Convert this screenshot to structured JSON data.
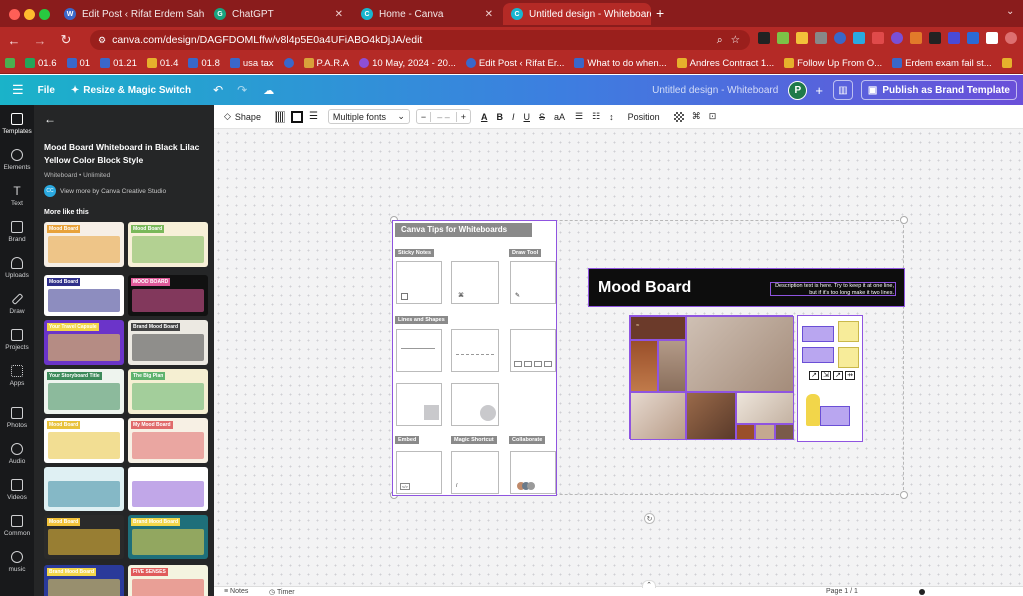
{
  "browser": {
    "tabs": [
      {
        "title": "Edit Post ‹ Rifat Erdem Sahin",
        "icon": "wordpress-icon",
        "color": "#3a67c9"
      },
      {
        "title": "ChatGPT",
        "icon": "chatgpt-icon",
        "color": "#19a37f"
      },
      {
        "title": "Home - Canva",
        "icon": "canva-icon",
        "color": "#18b5cf"
      },
      {
        "title": "Untitled design - Whiteboard",
        "icon": "canva-icon",
        "color": "#18b5cf"
      }
    ],
    "url": "canva.com/design/DAGFDOMLffw/v8l4p5E0a4UFiABO4kDjJA/edit",
    "bookmarks": [
      {
        "label": "01.6",
        "color": "#23a55a"
      },
      {
        "label": "01",
        "color": "#3a67c9"
      },
      {
        "label": "01.21",
        "color": "#3a67c9"
      },
      {
        "label": "01.4",
        "color": "#e6b02c"
      },
      {
        "label": "01.8",
        "color": "#3a67c9"
      },
      {
        "label": "usa tax",
        "color": "#3a67c9"
      },
      {
        "label": "",
        "color": "#3a67c9"
      },
      {
        "label": "P.A.R.A",
        "color": "#d9a13a"
      },
      {
        "label": "10 May, 2024 - 20...",
        "color": "#8e4fd6"
      },
      {
        "label": "Edit Post ‹ Rifat Er...",
        "color": "#3a67c9"
      },
      {
        "label": "What to do when...",
        "color": "#3a67c9"
      },
      {
        "label": "Andres Contract 1...",
        "color": "#e6b02c"
      },
      {
        "label": "Follow Up From O...",
        "color": "#e6b02c"
      },
      {
        "label": "Erdem exam fail st...",
        "color": "#3a67c9"
      }
    ]
  },
  "canva": {
    "menu": {
      "file": "File",
      "resize": "Resize & Magic Switch"
    },
    "doc_title": "Untitled design - Whiteboard",
    "avatar_initial": "P",
    "publish": "Publish as Brand Template",
    "sidebar": [
      {
        "label": "Templates",
        "icon": "templates-icon"
      },
      {
        "label": "Elements",
        "icon": "elements-icon"
      },
      {
        "label": "Text",
        "icon": "text-icon"
      },
      {
        "label": "Brand",
        "icon": "brand-icon"
      },
      {
        "label": "Uploads",
        "icon": "uploads-icon"
      },
      {
        "label": "Draw",
        "icon": "draw-icon"
      },
      {
        "label": "Projects",
        "icon": "projects-icon"
      },
      {
        "label": "Apps",
        "icon": "apps-icon"
      },
      {
        "label": "Photos",
        "icon": "photos-icon"
      },
      {
        "label": "Audio",
        "icon": "audio-icon"
      },
      {
        "label": "Videos",
        "icon": "videos-icon"
      },
      {
        "label": "Common",
        "icon": "common-icon"
      },
      {
        "label": "music",
        "icon": "music-icon"
      }
    ],
    "panel": {
      "title": "Mood Board Whiteboard in Black Lilac Yellow Color Block Style",
      "meta": "Whiteboard • Unlimited",
      "author": "View more by Canva Creative Studio",
      "author_initials": "CC",
      "more_like": "More like this",
      "thumbs": [
        {
          "label": "Mood Board",
          "bg": "#f6efe6",
          "accent": "#e8a23a"
        },
        {
          "label": "Mood Board",
          "bg": "#f8f0d8",
          "accent": "#7ab85a"
        },
        {
          "label": "Mood Board",
          "bg": "#ffffff",
          "accent": "#2f2f8a"
        },
        {
          "label": "MOOD BOARD",
          "bg": "#111111",
          "accent": "#e05a9a"
        },
        {
          "label": "Your Travel Capsule",
          "bg": "#6b34c9",
          "accent": "#f2d64a"
        },
        {
          "label": "Brand Mood Board",
          "bg": "#ece9e2",
          "accent": "#444444"
        },
        {
          "label": "Your Storyboard Title",
          "bg": "#eef4ee",
          "accent": "#3c8a5a"
        },
        {
          "label": "The Big Plan",
          "bg": "#f5efd2",
          "accent": "#5fb36e"
        },
        {
          "label": "Mood Board",
          "bg": "#ffffff",
          "accent": "#e8c23a"
        },
        {
          "label": "My Mood Board",
          "bg": "#f7f0e4",
          "accent": "#e06a6a"
        },
        {
          "label": "",
          "bg": "#dff0f3",
          "accent": "#3a8aa0"
        },
        {
          "label": "",
          "bg": "#ffffff",
          "accent": "#8e5ed6"
        },
        {
          "label": "Mood Board",
          "bg": "#2a2a2a",
          "accent": "#f2c23a"
        },
        {
          "label": "Brand Mood Board",
          "bg": "#1e6f7a",
          "accent": "#f2d64a"
        },
        {
          "label": "Brand Mood Board",
          "bg": "#2a3a9a",
          "accent": "#f2d64a"
        },
        {
          "label": "FIVE SENSES",
          "bg": "#f4f4e0",
          "accent": "#e05a5a"
        }
      ]
    },
    "toolbar": {
      "shape": "Shape",
      "font": "Multiple fonts",
      "font_size": "– –",
      "position": "Position"
    },
    "board": {
      "tips_title": "Canva Tips for Whiteboards",
      "sections": [
        "Sticky Notes",
        "Draw Tool",
        "Lines and Shapes",
        "Embed",
        "Magic Shortcut",
        "Collaborate"
      ],
      "mood_title": "Mood Board",
      "mood_desc": "Description text is here. Try to keep it at one line, but if it's too long make it two lines."
    },
    "footer": {
      "notes": "Notes",
      "timer": "Timer",
      "page": "Page 1 / 1"
    }
  },
  "colors": {
    "tabbar": "#8a1c1c",
    "browser": "#b42a26",
    "purple": "#8f54e0",
    "yellow": "#f7ec9a",
    "lilac": "#b9a6f0"
  }
}
